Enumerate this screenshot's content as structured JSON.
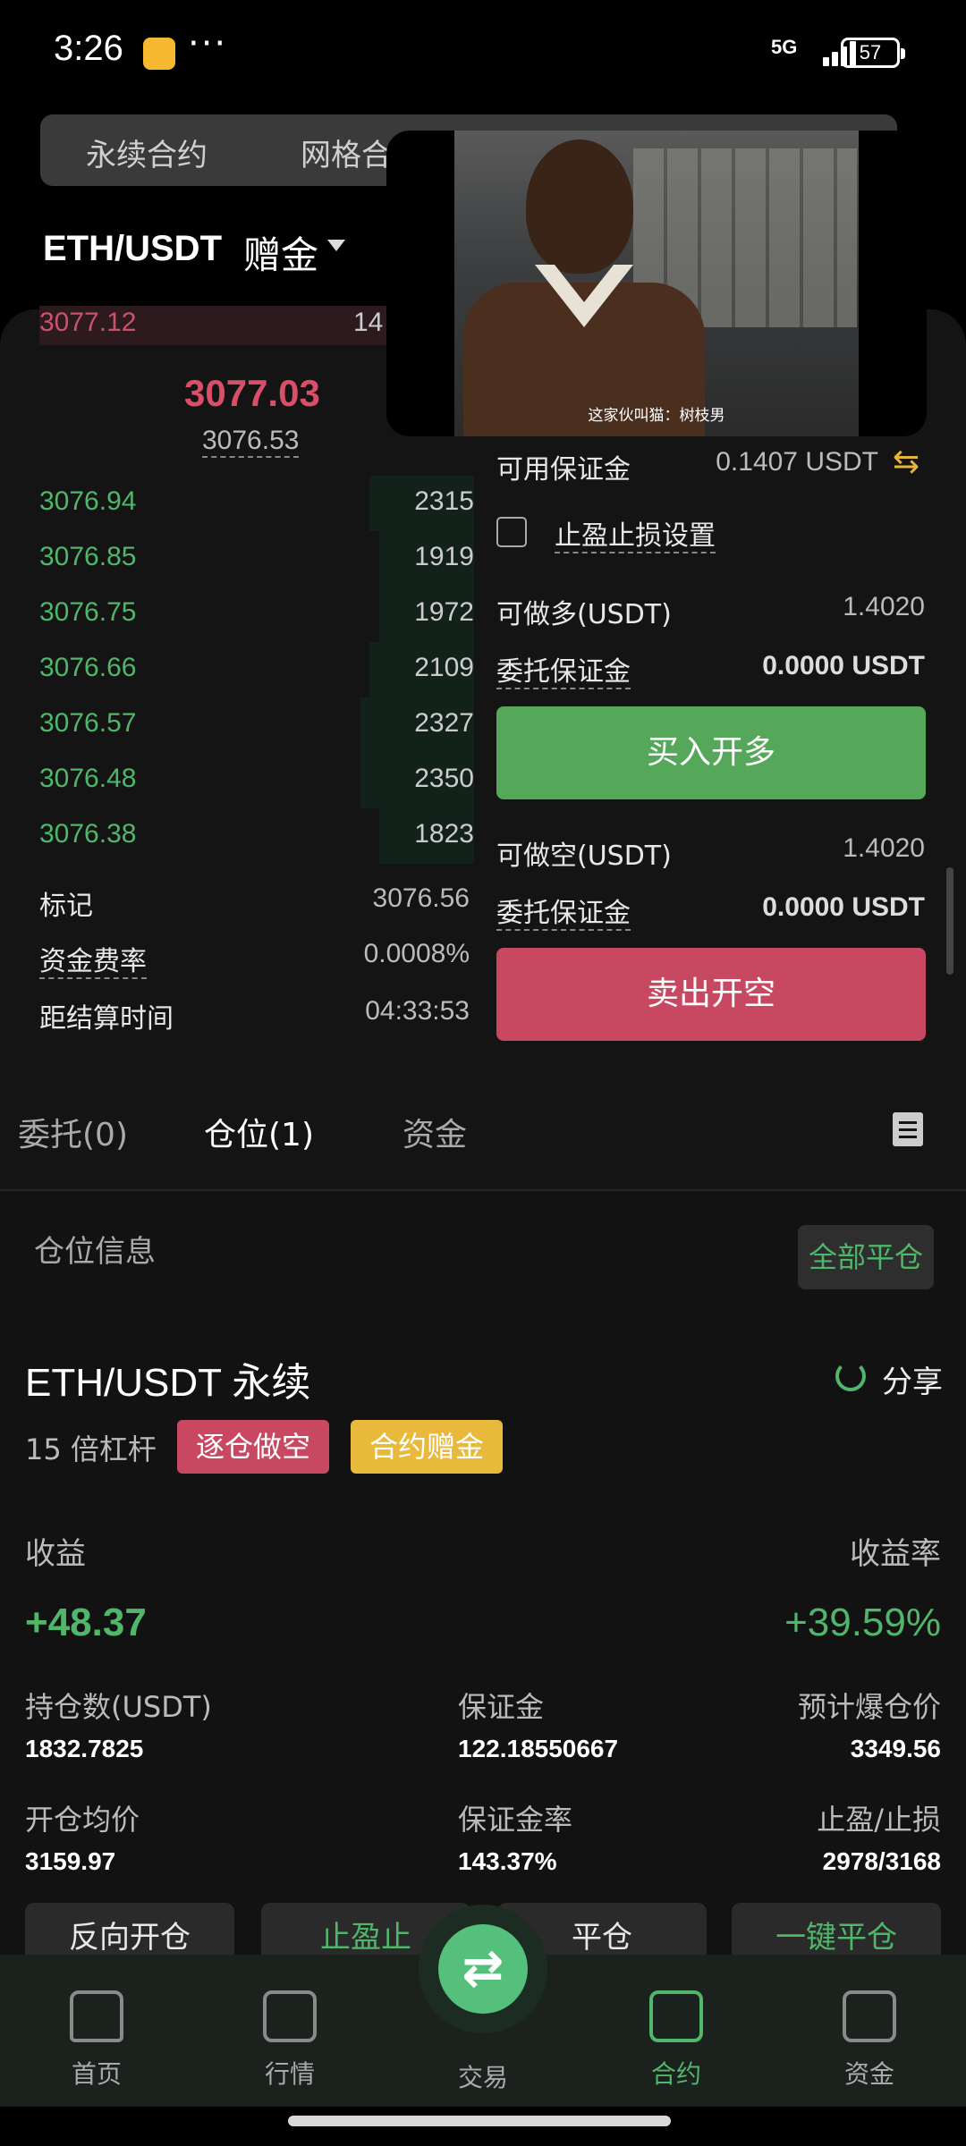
{
  "status": {
    "time": "3:26",
    "dots": "···",
    "network": "5G",
    "battery": "57"
  },
  "segment": {
    "tabs": [
      "永续合约",
      "网格合"
    ]
  },
  "pair": {
    "symbol": "ETH/USDT",
    "bonus": "赠金"
  },
  "orderbook": {
    "ask": {
      "price": "3077.12",
      "qty": "14"
    },
    "last_price": "3077.03",
    "index_price": "3076.53",
    "bids": [
      {
        "price": "3076.94",
        "qty": "2315",
        "depth": 0.22
      },
      {
        "price": "3076.85",
        "qty": "1919",
        "depth": 0.2
      },
      {
        "price": "3076.75",
        "qty": "1972",
        "depth": 0.2
      },
      {
        "price": "3076.66",
        "qty": "2109",
        "depth": 0.22
      },
      {
        "price": "3076.57",
        "qty": "2327",
        "depth": 0.24
      },
      {
        "price": "3076.48",
        "qty": "2350",
        "depth": 0.24
      },
      {
        "price": "3076.38",
        "qty": "1823",
        "depth": 0.2
      }
    ]
  },
  "info": {
    "mark_label": "标记",
    "mark_value": "3076.56",
    "funding_label": "资金费率",
    "funding_value": "0.0008%",
    "settle_label": "距结算时间",
    "settle_value": "04:33:53"
  },
  "video": {
    "caption": "这家伙叫猫：树枝男"
  },
  "trade": {
    "avail_label": "可用保证金",
    "avail_value": "0.1407 USDT",
    "tpsl_label": "止盈止损设置",
    "long_label": "可做多(USDT)",
    "long_value": "1.4020",
    "long_margin_label": "委托保证金",
    "long_margin_value": "0.0000 USDT",
    "buy_button": "买入开多",
    "short_label": "可做空(USDT)",
    "short_value": "1.4020",
    "short_margin_label": "委托保证金",
    "short_margin_value": "0.0000 USDT",
    "sell_button": "卖出开空"
  },
  "tabs": {
    "orders": "委托(0)",
    "positions": "仓位(1)",
    "funds": "资金"
  },
  "position": {
    "section_title": "仓位信息",
    "close_all": "全部平仓",
    "name": "ETH/USDT 永续",
    "share": "分享",
    "leverage": "15 倍杠杆",
    "badge_mode": "逐仓做空",
    "badge_bonus": "合约赠金",
    "pnl_label": "收益",
    "pnl_rate_label": "收益率",
    "pnl": "+48.37",
    "pnl_rate": "+39.59%",
    "size_label": "持仓数(USDT)",
    "size": "1832.7825",
    "margin_label": "保证金",
    "margin": "122.18550667",
    "liq_label": "预计爆仓价",
    "liq": "3349.56",
    "entry_label": "开仓均价",
    "entry": "3159.97",
    "margin_rate_label": "保证金率",
    "margin_rate": "143.37%",
    "tpsl_label": "止盈/止损",
    "tpsl": "2978/3168",
    "actions": [
      "反向开仓",
      "止盈止",
      "平仓",
      "一键平仓"
    ]
  },
  "nav": {
    "home": "首页",
    "market": "行情",
    "trade": "交易",
    "contract": "合约",
    "assets": "资金"
  },
  "colors": {
    "green": "#4fb66a",
    "red": "#c84862",
    "yellow": "#e8b93a"
  }
}
